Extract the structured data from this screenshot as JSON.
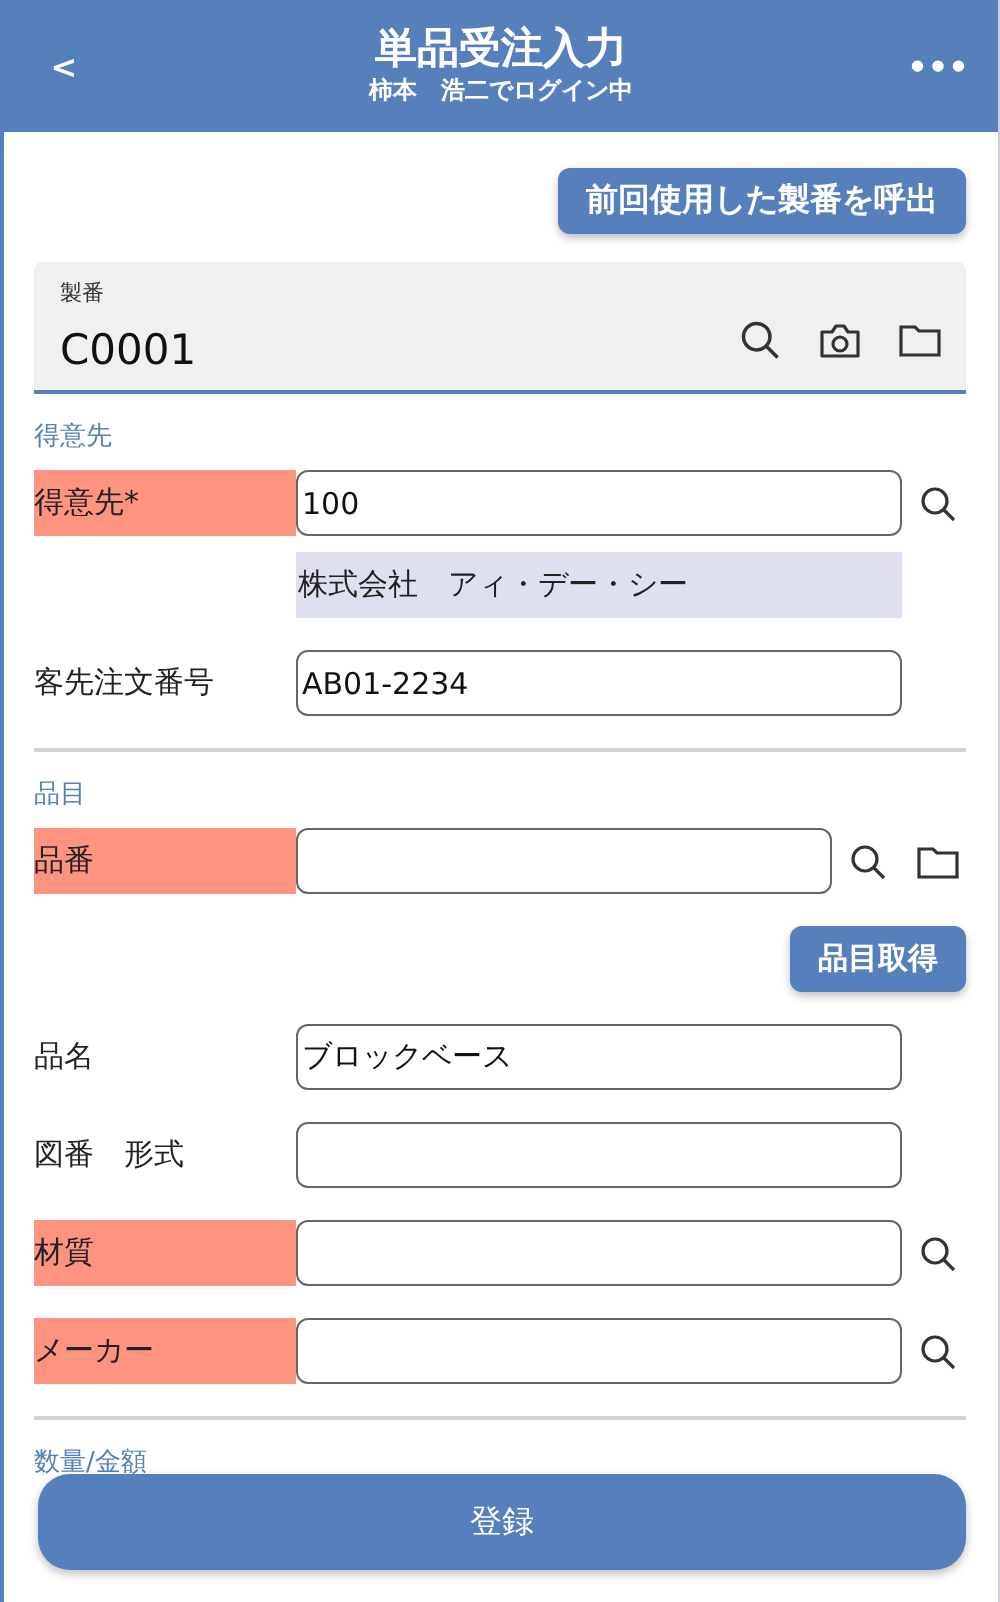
{
  "header": {
    "back": "<",
    "title": "単品受注入力",
    "subtitle": "柿本　浩二でログイン中",
    "menu": "•••"
  },
  "recall_button": "前回使用した製番を呼出",
  "lot_field": {
    "label": "製番",
    "value": "C0001",
    "focused": true
  },
  "sections": [
    {
      "title": "得意先",
      "rows": [
        {
          "kind": "input",
          "label": "得意先*",
          "required": true,
          "value": "100",
          "search": true,
          "browse": false
        },
        {
          "kind": "display",
          "value": "株式会社　アィ・デー・シー"
        },
        {
          "kind": "input",
          "label": "客先注文番号",
          "required": false,
          "value": "AB01-2234",
          "search": false,
          "browse": false
        }
      ]
    },
    {
      "title": "品目",
      "rows": [
        {
          "kind": "input",
          "label": "品番",
          "required": true,
          "value": "",
          "search": true,
          "browse": true
        },
        {
          "kind": "button",
          "label": "品目取得"
        },
        {
          "kind": "input",
          "label": "品名",
          "required": false,
          "value": "ブロックベース",
          "search": false,
          "browse": false
        },
        {
          "kind": "input",
          "label": "図番　形式",
          "required": false,
          "value": "",
          "search": false,
          "browse": false
        },
        {
          "kind": "input",
          "label": "材質",
          "required": true,
          "value": "",
          "search": true,
          "browse": false
        },
        {
          "kind": "input",
          "label": "メーカー",
          "required": true,
          "value": "",
          "search": true,
          "browse": false
        }
      ]
    },
    {
      "title": "数量/金額"
    }
  ],
  "submit_button": "登録"
}
